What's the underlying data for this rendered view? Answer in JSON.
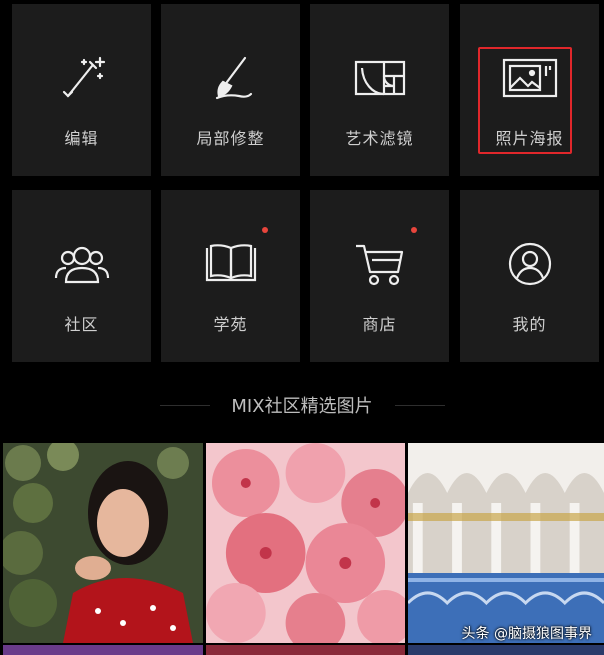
{
  "tools": [
    {
      "label": "编辑",
      "icon": "magic-wand-icon"
    },
    {
      "label": "局部修整",
      "icon": "brush-icon"
    },
    {
      "label": "艺术滤镜",
      "icon": "golden-ratio-filter-icon"
    },
    {
      "label": "照片海报",
      "icon": "photo-poster-icon"
    }
  ],
  "nav": [
    {
      "label": "社区",
      "icon": "community-icon",
      "badge": false
    },
    {
      "label": "学苑",
      "icon": "book-icon",
      "badge": true
    },
    {
      "label": "商店",
      "icon": "cart-icon",
      "badge": true
    },
    {
      "label": "我的",
      "icon": "profile-icon",
      "badge": false
    }
  ],
  "section": {
    "title": "MIX社区精选图片"
  },
  "photos": [
    {
      "name": "portrait-photo"
    },
    {
      "name": "cherry-blossom-photo"
    },
    {
      "name": "mosque-photo"
    }
  ],
  "watermark": "头条 @脑摄狼图事界",
  "colors": {
    "background": "#000000",
    "tile": "#1c1c1c",
    "badge": "#e8453c",
    "highlight": "#e0272b"
  }
}
